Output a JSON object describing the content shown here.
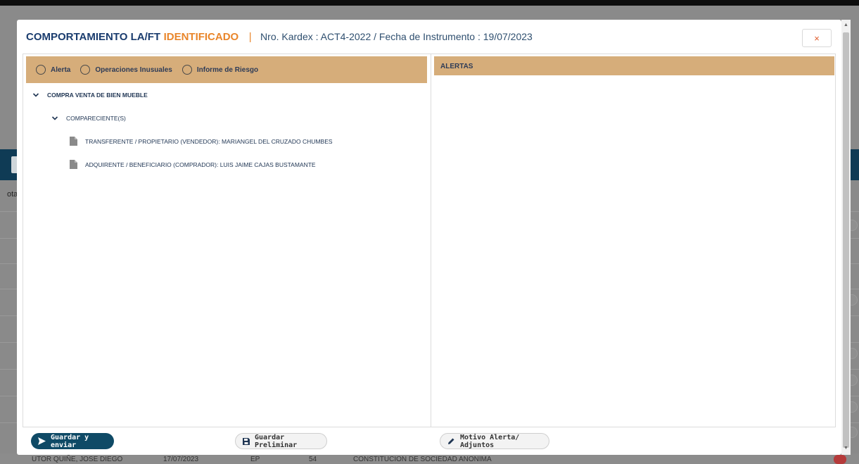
{
  "modal": {
    "title_strong": "COMPORTAMIENTO LA/FT",
    "title_accent": "IDENTIFICADO",
    "separator": "|",
    "meta": "Nro. Kardex : ACT4-2022 / Fecha de Instrumento : 19/07/2023",
    "close_label": "×"
  },
  "left_panel": {
    "options": [
      {
        "label": "Alerta",
        "selected": false
      },
      {
        "label": "Operaciones Inusuales",
        "selected": false
      },
      {
        "label": "Informe de Riesgo",
        "selected": false
      }
    ],
    "tree": {
      "root_label": "COMPRA VENTA DE BIEN MUEBLE",
      "child_label": "COMPARECIENTE(S)",
      "leaves": [
        "TRANSFERENTE / PROPIETARIO (VENDEDOR): MARIANGEL DEL CRUZADO CHUMBES",
        "ADQUIRENTE / BENEFICIARIO (COMPRADOR): LUIS JAIME CAJAS BUSTAMANTE"
      ]
    }
  },
  "right_panel": {
    "header": "ALERTAS"
  },
  "footer": {
    "send_label": "Guardar y enviar",
    "save_label": "Guardar Preliminar",
    "reason_label": "Motivo Alerta/ Adjuntos"
  },
  "background": {
    "partial_label": "ota",
    "bottom_row": [
      "UTOR QUIÑE, JOSE DIEGO",
      "17/07/2023",
      "EP",
      "54",
      "CONSTITUCION DE SOCIEDAD ANONIMA"
    ]
  },
  "colors": {
    "accent_orange": "#e9862b",
    "primary_navy": "#1a3c6e",
    "tab_tan": "#d6ad7a",
    "button_teal": "#0f4a66"
  }
}
